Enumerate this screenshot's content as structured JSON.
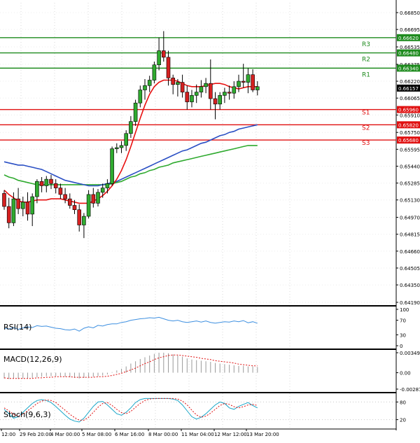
{
  "chart_data": {
    "type": "candlestick",
    "price_panel": {
      "ylim": [
        0.6419,
        0.6694
      ],
      "y_ticks": [
        "0.66850",
        "0.66695",
        "0.66535",
        "0.66375",
        "0.66220",
        "0.66065",
        "0.65910",
        "0.65750",
        "0.65595",
        "0.65440",
        "0.65285",
        "0.65130",
        "0.64970",
        "0.64815",
        "0.64660",
        "0.64505",
        "0.64350",
        "0.64190"
      ],
      "current_price": "0.66157",
      "levels": [
        {
          "name": "R3",
          "value": 0.6662,
          "label": "0.66620",
          "kind": "resistance"
        },
        {
          "name": "R2",
          "value": 0.6648,
          "label": "0.66480",
          "kind": "resistance"
        },
        {
          "name": "R1",
          "value": 0.6634,
          "label": "0.66340",
          "kind": "resistance"
        },
        {
          "name": "S1",
          "value": 0.6596,
          "label": "0.65960",
          "kind": "support"
        },
        {
          "name": "S2",
          "value": 0.6582,
          "label": "0.65820",
          "kind": "support"
        },
        {
          "name": "S3",
          "value": 0.6568,
          "label": "0.65680",
          "kind": "support"
        }
      ],
      "candles": [
        [
          0.6519,
          0.6522,
          0.6504,
          0.6507
        ],
        [
          0.6507,
          0.6515,
          0.6487,
          0.6492
        ],
        [
          0.6492,
          0.652,
          0.6489,
          0.6514
        ],
        [
          0.6514,
          0.6524,
          0.65,
          0.6505
        ],
        [
          0.6505,
          0.6516,
          0.6498,
          0.6511
        ],
        [
          0.6511,
          0.652,
          0.6494,
          0.65
        ],
        [
          0.65,
          0.6519,
          0.6489,
          0.6516
        ],
        [
          0.6516,
          0.6532,
          0.651,
          0.653
        ],
        [
          0.653,
          0.6534,
          0.652,
          0.6526
        ],
        [
          0.6526,
          0.6535,
          0.652,
          0.6532
        ],
        [
          0.6532,
          0.6536,
          0.6523,
          0.6528
        ],
        [
          0.6528,
          0.6532,
          0.6519,
          0.6524
        ],
        [
          0.6524,
          0.6528,
          0.6514,
          0.6518
        ],
        [
          0.6518,
          0.6524,
          0.651,
          0.6514
        ],
        [
          0.6514,
          0.6519,
          0.6505,
          0.6508
        ],
        [
          0.6508,
          0.6513,
          0.65,
          0.6504
        ],
        [
          0.6504,
          0.6509,
          0.6484,
          0.649
        ],
        [
          0.649,
          0.6501,
          0.6478,
          0.6498
        ],
        [
          0.6498,
          0.6522,
          0.6496,
          0.6518
        ],
        [
          0.6518,
          0.6524,
          0.6506,
          0.651
        ],
        [
          0.651,
          0.6523,
          0.6507,
          0.652
        ],
        [
          0.652,
          0.6528,
          0.6515,
          0.6524
        ],
        [
          0.6524,
          0.6532,
          0.6519,
          0.6528
        ],
        [
          0.6528,
          0.6562,
          0.6526,
          0.656
        ],
        [
          0.656,
          0.6565,
          0.6556,
          0.6561
        ],
        [
          0.6561,
          0.6567,
          0.6556,
          0.6563
        ],
        [
          0.6563,
          0.6577,
          0.6558,
          0.6574
        ],
        [
          0.6574,
          0.659,
          0.657,
          0.6585
        ],
        [
          0.6585,
          0.6605,
          0.6581,
          0.6602
        ],
        [
          0.6602,
          0.6618,
          0.6598,
          0.6614
        ],
        [
          0.6614,
          0.6624,
          0.6605,
          0.6618
        ],
        [
          0.6618,
          0.6627,
          0.6612,
          0.6623
        ],
        [
          0.6623,
          0.664,
          0.662,
          0.6637
        ],
        [
          0.6637,
          0.6662,
          0.6632,
          0.665
        ],
        [
          0.665,
          0.6668,
          0.664,
          0.6644
        ],
        [
          0.6644,
          0.665,
          0.6618,
          0.6625
        ],
        [
          0.6625,
          0.6628,
          0.661,
          0.6619
        ],
        [
          0.6619,
          0.6624,
          0.6608,
          0.6621
        ],
        [
          0.6621,
          0.6628,
          0.6607,
          0.6612
        ],
        [
          0.6612,
          0.6618,
          0.6596,
          0.6603
        ],
        [
          0.6603,
          0.6614,
          0.6598,
          0.6609
        ],
        [
          0.6609,
          0.6619,
          0.6602,
          0.6612
        ],
        [
          0.6612,
          0.6623,
          0.6607,
          0.6617
        ],
        [
          0.6617,
          0.6625,
          0.6611,
          0.662
        ],
        [
          0.662,
          0.6642,
          0.6596,
          0.6606
        ],
        [
          0.6606,
          0.6612,
          0.6587,
          0.6601
        ],
        [
          0.6601,
          0.6612,
          0.6596,
          0.6609
        ],
        [
          0.6609,
          0.6616,
          0.6602,
          0.6612
        ],
        [
          0.6612,
          0.6618,
          0.6605,
          0.6611
        ],
        [
          0.6611,
          0.6622,
          0.6606,
          0.6617
        ],
        [
          0.6617,
          0.6628,
          0.6612,
          0.6622
        ],
        [
          0.6622,
          0.6638,
          0.6616,
          0.6621
        ],
        [
          0.6621,
          0.6634,
          0.6611,
          0.6628
        ],
        [
          0.6628,
          0.6633,
          0.6612,
          0.6614
        ],
        [
          0.6614,
          0.6622,
          0.6609,
          0.6617
        ]
      ],
      "ma_fast": {
        "color": "#e81010",
        "values": [
          0.6522,
          0.6518,
          0.6515,
          0.6512,
          0.6511,
          0.6511,
          0.6512,
          0.6513,
          0.6513,
          0.6513,
          0.6514,
          0.6514,
          0.6514,
          0.6513,
          0.6512,
          0.6511,
          0.651,
          0.651,
          0.651,
          0.6512,
          0.6514,
          0.6517,
          0.6521,
          0.6526,
          0.6532,
          0.654,
          0.655,
          0.6562,
          0.6575,
          0.6588,
          0.66,
          0.661,
          0.6617,
          0.6621,
          0.6623,
          0.6623,
          0.6623,
          0.6622,
          0.662,
          0.6618,
          0.6617,
          0.6617,
          0.6617,
          0.6618,
          0.6619,
          0.662,
          0.662,
          0.6619,
          0.6617,
          0.6616,
          0.6615,
          0.6616,
          0.6617,
          0.6617,
          0.6617
        ]
      },
      "ma_mid": {
        "color": "#2a4fc4",
        "values": [
          0.6548,
          0.6547,
          0.6546,
          0.6545,
          0.6545,
          0.6544,
          0.6543,
          0.6542,
          0.6541,
          0.6539,
          0.6537,
          0.6535,
          0.6533,
          0.6531,
          0.653,
          0.6529,
          0.6528,
          0.6527,
          0.6526,
          0.6526,
          0.6526,
          0.6527,
          0.6528,
          0.6529,
          0.653,
          0.6532,
          0.6534,
          0.6536,
          0.6538,
          0.654,
          0.6542,
          0.6544,
          0.6546,
          0.6548,
          0.655,
          0.6552,
          0.6554,
          0.6556,
          0.6558,
          0.6559,
          0.6561,
          0.6563,
          0.6565,
          0.6566,
          0.6568,
          0.657,
          0.6572,
          0.6573,
          0.6575,
          0.6576,
          0.6578,
          0.6579,
          0.658,
          0.6581,
          0.6582
        ]
      },
      "ma_slow": {
        "color": "#2faa2f",
        "values": [
          0.6536,
          0.6534,
          0.6533,
          0.6531,
          0.653,
          0.6529,
          0.6528,
          0.6527,
          0.6527,
          0.6527,
          0.6527,
          0.6527,
          0.6527,
          0.6527,
          0.6527,
          0.6527,
          0.6527,
          0.6527,
          0.6527,
          0.6527,
          0.6527,
          0.6527,
          0.6527,
          0.6528,
          0.6529,
          0.653,
          0.6532,
          0.6534,
          0.6535,
          0.6537,
          0.6538,
          0.654,
          0.6541,
          0.6543,
          0.6544,
          0.6545,
          0.6547,
          0.6548,
          0.6549,
          0.655,
          0.6551,
          0.6552,
          0.6553,
          0.6554,
          0.6555,
          0.6556,
          0.6557,
          0.6558,
          0.6559,
          0.656,
          0.6561,
          0.6562,
          0.6563,
          0.6563,
          0.6563
        ]
      }
    },
    "x_labels": [
      "12:00",
      "29 Feb 20:00",
      "4 Mar 00:00",
      "5 Mar 08:00",
      "6 Mar 16:00",
      "8 Mar 00:00",
      "11 Mar 04:00",
      "12 Mar 12:00",
      "13 Mar 20:00"
    ],
    "rsi": {
      "label": "RSI(14)",
      "ylim": [
        0,
        100
      ],
      "ticks": [
        "100",
        "70",
        "30",
        "0"
      ],
      "color": "#3d8fe0",
      "values": [
        48,
        46,
        50,
        45,
        49,
        52,
        50,
        55,
        53,
        54,
        51,
        48,
        47,
        44,
        43,
        46,
        40,
        48,
        52,
        49,
        56,
        54,
        58,
        60,
        60,
        64,
        66,
        70,
        72,
        74,
        75,
        77,
        76,
        78,
        74,
        70,
        68,
        70,
        66,
        64,
        66,
        68,
        65,
        68,
        64,
        62,
        64,
        66,
        65,
        68,
        66,
        69,
        63,
        66,
        62
      ]
    },
    "macd": {
      "label": "MACD(12,26,9)",
      "ticks": [
        "0.003495",
        "0.00",
        "-0.00287"
      ],
      "ylim": [
        -0.00287,
        0.003495
      ],
      "hist_color": "#9a9a9a",
      "signal_color": "#e01010",
      "hist": [
        -0.001,
        -0.0011,
        -0.001,
        -0.0011,
        -0.001,
        -0.001,
        -0.0009,
        -0.0008,
        -0.0007,
        -0.0006,
        -0.0006,
        -0.0006,
        -0.0006,
        -0.0007,
        -0.0008,
        -0.0009,
        -0.001,
        -0.0009,
        -0.0008,
        -0.0007,
        -0.0006,
        -0.0005,
        -0.0003,
        0.0001,
        0.0004,
        0.0007,
        0.0011,
        0.0016,
        0.002,
        0.0024,
        0.0027,
        0.003,
        0.0033,
        0.0035,
        0.0035,
        0.0034,
        0.0032,
        0.003,
        0.0028,
        0.0025,
        0.0023,
        0.0022,
        0.0021,
        0.002,
        0.0019,
        0.0017,
        0.0016,
        0.0015,
        0.0014,
        0.0013,
        0.0012,
        0.0012,
        0.0011,
        0.0011,
        0.001
      ],
      "signal": [
        -0.0009,
        -0.001,
        -0.001,
        -0.001,
        -0.001,
        -0.001,
        -0.001,
        -0.0009,
        -0.0009,
        -0.0008,
        -0.0008,
        -0.0007,
        -0.0007,
        -0.0007,
        -0.0007,
        -0.0008,
        -0.0008,
        -0.0008,
        -0.0008,
        -0.0008,
        -0.0007,
        -0.0007,
        -0.0006,
        -0.0005,
        -0.0003,
        -0.0001,
        0.0002,
        0.0005,
        0.0008,
        0.0012,
        0.0016,
        0.0019,
        0.0023,
        0.0026,
        0.0028,
        0.003,
        0.0031,
        0.0031,
        0.003,
        0.0029,
        0.0028,
        0.0027,
        0.0025,
        0.0024,
        0.0023,
        0.0021,
        0.002,
        0.0019,
        0.0018,
        0.0017,
        0.0015,
        0.0014,
        0.0013,
        0.0012,
        0.0012
      ]
    },
    "stoch": {
      "label": "Stoch(9,6,3)",
      "ticks": [
        "80",
        "20"
      ],
      "ylim": [
        0,
        100
      ],
      "k_color": "#1aa6c8",
      "d_color": "#e01010",
      "k": [
        55,
        40,
        25,
        30,
        45,
        60,
        75,
        85,
        88,
        85,
        78,
        65,
        50,
        35,
        22,
        15,
        12,
        25,
        45,
        65,
        80,
        82,
        70,
        55,
        40,
        35,
        45,
        60,
        78,
        88,
        92,
        92,
        92,
        92,
        92,
        92,
        90,
        85,
        70,
        50,
        30,
        22,
        28,
        40,
        55,
        70,
        80,
        75,
        60,
        55,
        65,
        72,
        78,
        68,
        60
      ],
      "d": [
        60,
        50,
        38,
        32,
        38,
        50,
        62,
        75,
        83,
        87,
        85,
        78,
        65,
        52,
        38,
        27,
        18,
        18,
        28,
        45,
        62,
        75,
        78,
        68,
        55,
        44,
        40,
        48,
        62,
        75,
        85,
        90,
        92,
        92,
        92,
        92,
        92,
        90,
        83,
        70,
        52,
        36,
        28,
        32,
        42,
        55,
        68,
        75,
        72,
        64,
        60,
        64,
        70,
        72,
        68
      ]
    }
  }
}
